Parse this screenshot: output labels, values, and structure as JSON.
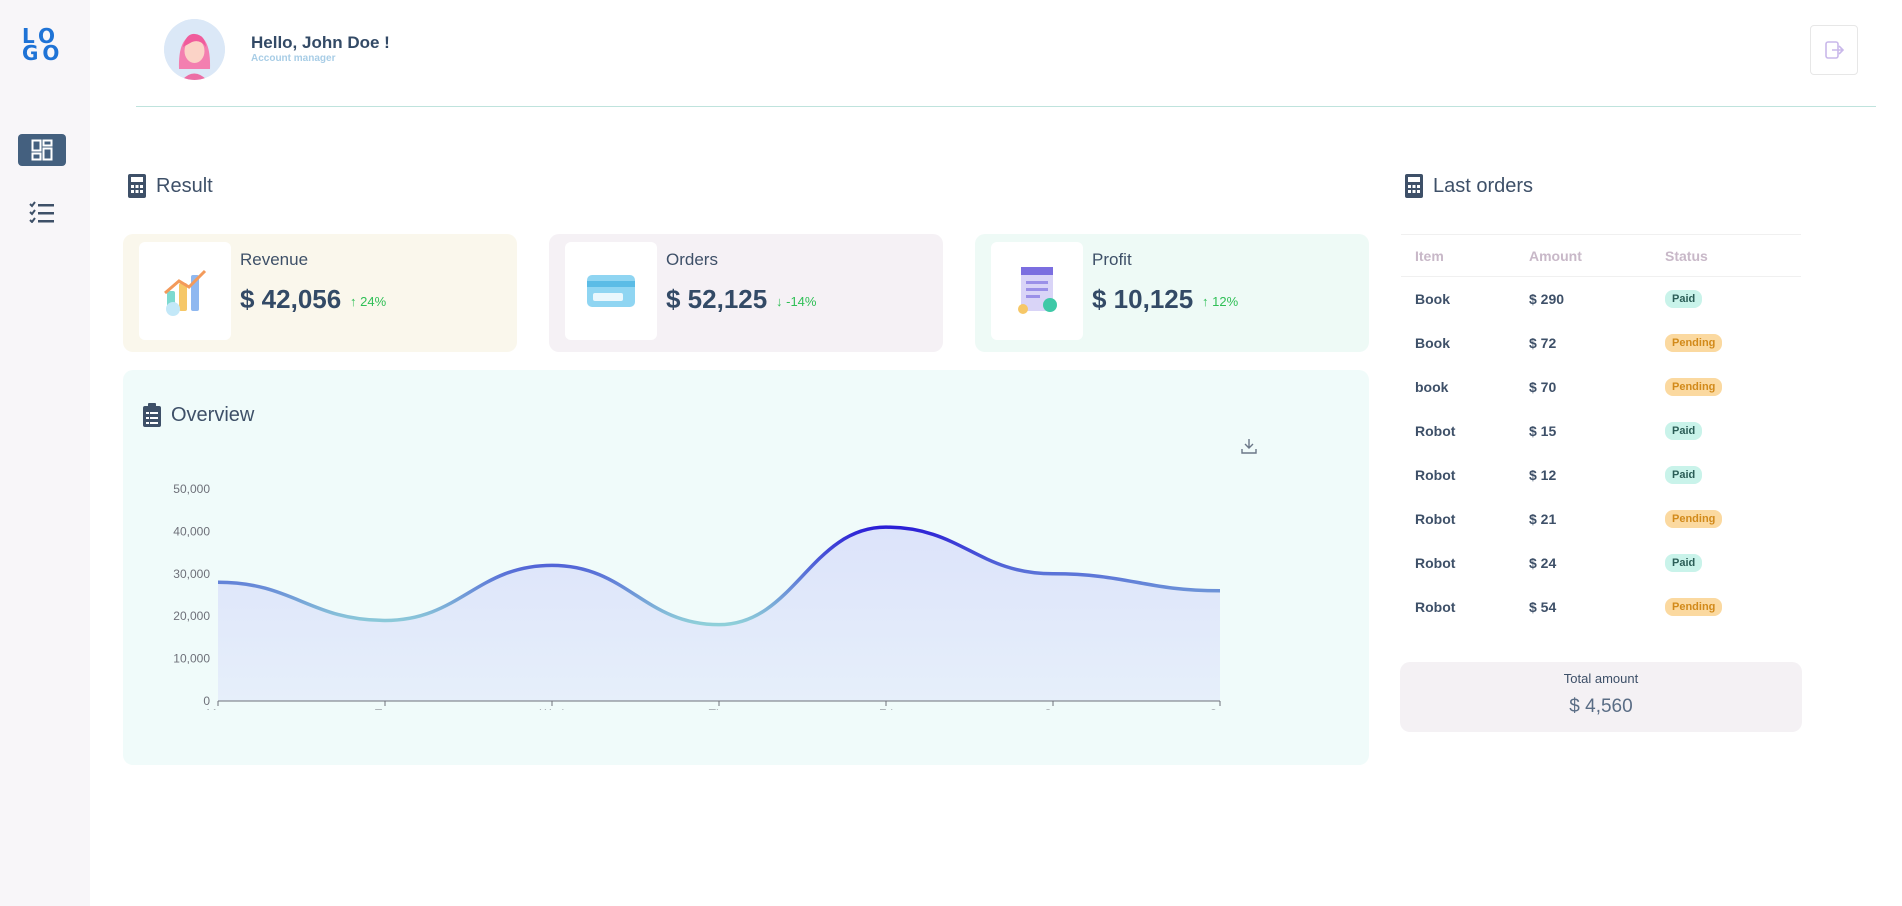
{
  "sidebar": {
    "logo": "LOGO",
    "nav": [
      {
        "name": "dashboard",
        "icon": "dashboard-icon",
        "active": true
      },
      {
        "name": "list",
        "icon": "checklist-icon",
        "active": false
      }
    ]
  },
  "header": {
    "greeting": "Hello, John Doe !",
    "role": "Account manager",
    "logout_icon": "logout-icon"
  },
  "result": {
    "title": "Result",
    "cards": [
      {
        "label": "Revenue",
        "value": "$ 42,056",
        "delta": "↑ 24%",
        "color": "#faf7ec",
        "icon": "growth-chart-icon"
      },
      {
        "label": "Orders",
        "value": "$ 52,125",
        "delta": "↓ -14%",
        "color": "#f5f1f5",
        "icon": "credit-card-icon"
      },
      {
        "label": "Profit",
        "value": "$ 10,125",
        "delta": "↑ 12%",
        "color": "#eefaf6",
        "icon": "invoice-icon"
      }
    ]
  },
  "overview": {
    "title": "Overview",
    "download_icon": "download-icon"
  },
  "chart_data": {
    "type": "area",
    "categories": [
      "Mon",
      "Tue",
      "Wed",
      "Thu",
      "Fri",
      "Sat",
      "Sun"
    ],
    "values": [
      28000,
      19000,
      32000,
      18000,
      41000,
      30000,
      26000
    ],
    "ylim": [
      0,
      50000
    ],
    "yticks": [
      "0",
      "10,000",
      "20,000",
      "30,000",
      "40,000",
      "50,000"
    ],
    "grid": false,
    "line_gradient": [
      "#8fd0d9",
      "#2b1fd6"
    ],
    "fill_color": "#dce3fa"
  },
  "last_orders": {
    "title": "Last orders",
    "columns": [
      "Item",
      "Amount",
      "Status"
    ],
    "rows": [
      {
        "item": "Book",
        "amount": "$ 290",
        "status": "Paid"
      },
      {
        "item": "Book",
        "amount": "$ 72",
        "status": "Pending"
      },
      {
        "item": "book",
        "amount": "$ 70",
        "status": "Pending"
      },
      {
        "item": "Robot",
        "amount": "$ 15",
        "status": "Paid"
      },
      {
        "item": "Robot",
        "amount": "$ 12",
        "status": "Paid"
      },
      {
        "item": "Robot",
        "amount": "$ 21",
        "status": "Pending"
      },
      {
        "item": "Robot",
        "amount": "$ 24",
        "status": "Paid"
      },
      {
        "item": "Robot",
        "amount": "$ 54",
        "status": "Pending"
      }
    ],
    "total_label": "Total amount",
    "total_value": "$ 4,560"
  }
}
